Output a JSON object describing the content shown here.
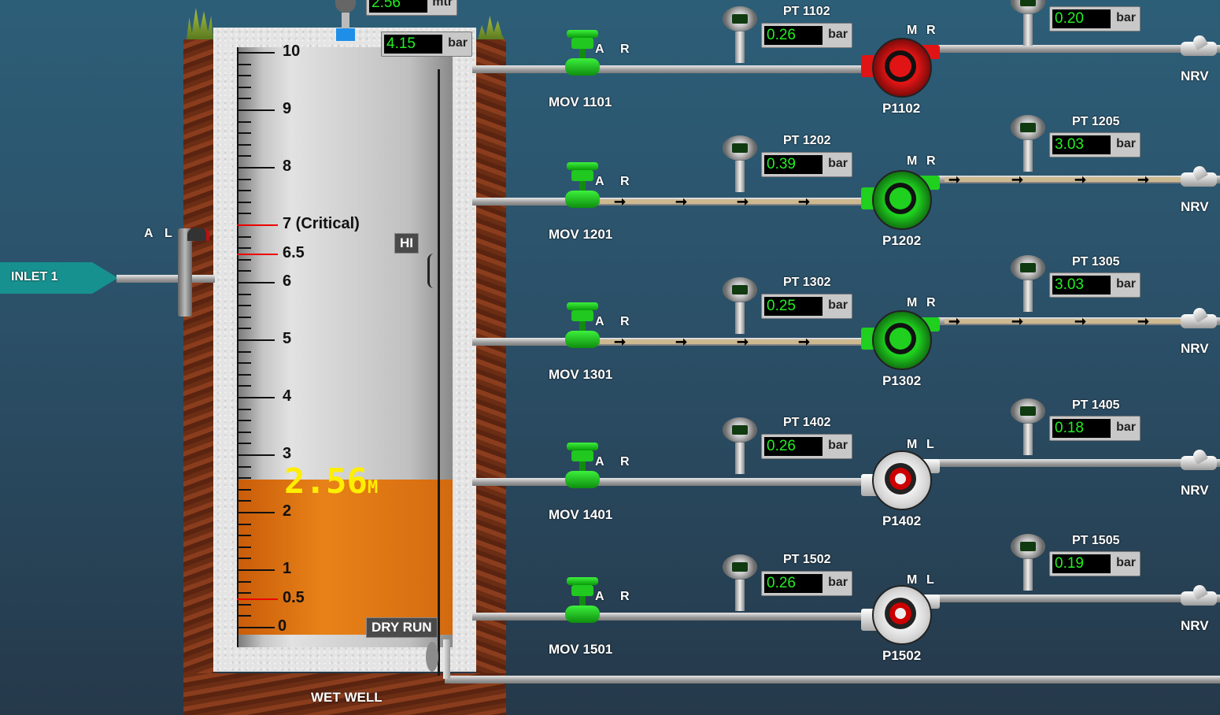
{
  "inlet": {
    "label": "INLET 1",
    "mode_a": "A",
    "mode_l": "L"
  },
  "wetwell": {
    "label": "WET WELL",
    "level_display": "2.56",
    "level_unit": "M",
    "level_top_value": "2.56",
    "level_top_unit": "mtr",
    "pressure_value": "4.15",
    "pressure_unit": "bar",
    "hi_label": "HI",
    "dry_run_label": "DRY RUN",
    "level_fraction": 0.256,
    "scale": [
      {
        "n": "10"
      },
      {
        "n": "9"
      },
      {
        "n": "8"
      },
      {
        "n": "7 (Critical)"
      },
      {
        "n": "6.5"
      },
      {
        "n": "6"
      },
      {
        "n": "5"
      },
      {
        "n": "4"
      },
      {
        "n": "3"
      },
      {
        "n": "2"
      },
      {
        "n": "1"
      },
      {
        "n": "0.5"
      },
      {
        "n": "0"
      }
    ]
  },
  "lines": [
    {
      "mov": "MOV 1101",
      "mov_a": "A",
      "mov_r": "R",
      "pt_suction": "PT 1102",
      "pt_suction_value": "0.26",
      "pt_suction_unit": "bar",
      "pump": "P1102",
      "pump_m": "M",
      "pump_r": "R",
      "pt_discharge": "",
      "pt_discharge_value": "0.20",
      "pt_discharge_unit": "bar",
      "nrv": "NRV",
      "state": "fault"
    },
    {
      "mov": "MOV 1201",
      "mov_a": "A",
      "mov_r": "R",
      "pt_suction": "PT 1202",
      "pt_suction_value": "0.39",
      "pt_suction_unit": "bar",
      "pump": "P1202",
      "pump_m": "M",
      "pump_r": "R",
      "pt_discharge": "PT 1205",
      "pt_discharge_value": "3.03",
      "pt_discharge_unit": "bar",
      "nrv": "NRV",
      "state": "running"
    },
    {
      "mov": "MOV 1301",
      "mov_a": "A",
      "mov_r": "R",
      "pt_suction": "PT 1302",
      "pt_suction_value": "0.25",
      "pt_suction_unit": "bar",
      "pump": "P1302",
      "pump_m": "M",
      "pump_r": "R",
      "pt_discharge": "PT 1305",
      "pt_discharge_value": "3.03",
      "pt_discharge_unit": "bar",
      "nrv": "NRV",
      "state": "running"
    },
    {
      "mov": "MOV 1401",
      "mov_a": "A",
      "mov_r": "R",
      "pt_suction": "PT 1402",
      "pt_suction_value": "0.26",
      "pt_suction_unit": "bar",
      "pump": "P1402",
      "pump_m": "M",
      "pump_r": "L",
      "pt_discharge": "PT 1405",
      "pt_discharge_value": "0.18",
      "pt_discharge_unit": "bar",
      "nrv": "NRV",
      "state": "stopped"
    },
    {
      "mov": "MOV 1501",
      "mov_a": "A",
      "mov_r": "R",
      "pt_suction": "PT 1502",
      "pt_suction_value": "0.26",
      "pt_suction_unit": "bar",
      "pump": "P1502",
      "pump_m": "M",
      "pump_r": "L",
      "pt_discharge": "PT 1505",
      "pt_discharge_value": "0.19",
      "pt_discharge_unit": "bar",
      "nrv": "NRV",
      "state": "stopped"
    }
  ],
  "colors": {
    "running": "#1fd01f",
    "fault": "#e01414",
    "stopped": "#d8d8d8",
    "display_text": "#22ee22",
    "level_fill": "#e07010"
  },
  "icons": {
    "valve": "valve-icon",
    "transmitter": "pressure-transmitter-icon",
    "pump": "pump-icon",
    "nrv": "check-valve-icon"
  }
}
